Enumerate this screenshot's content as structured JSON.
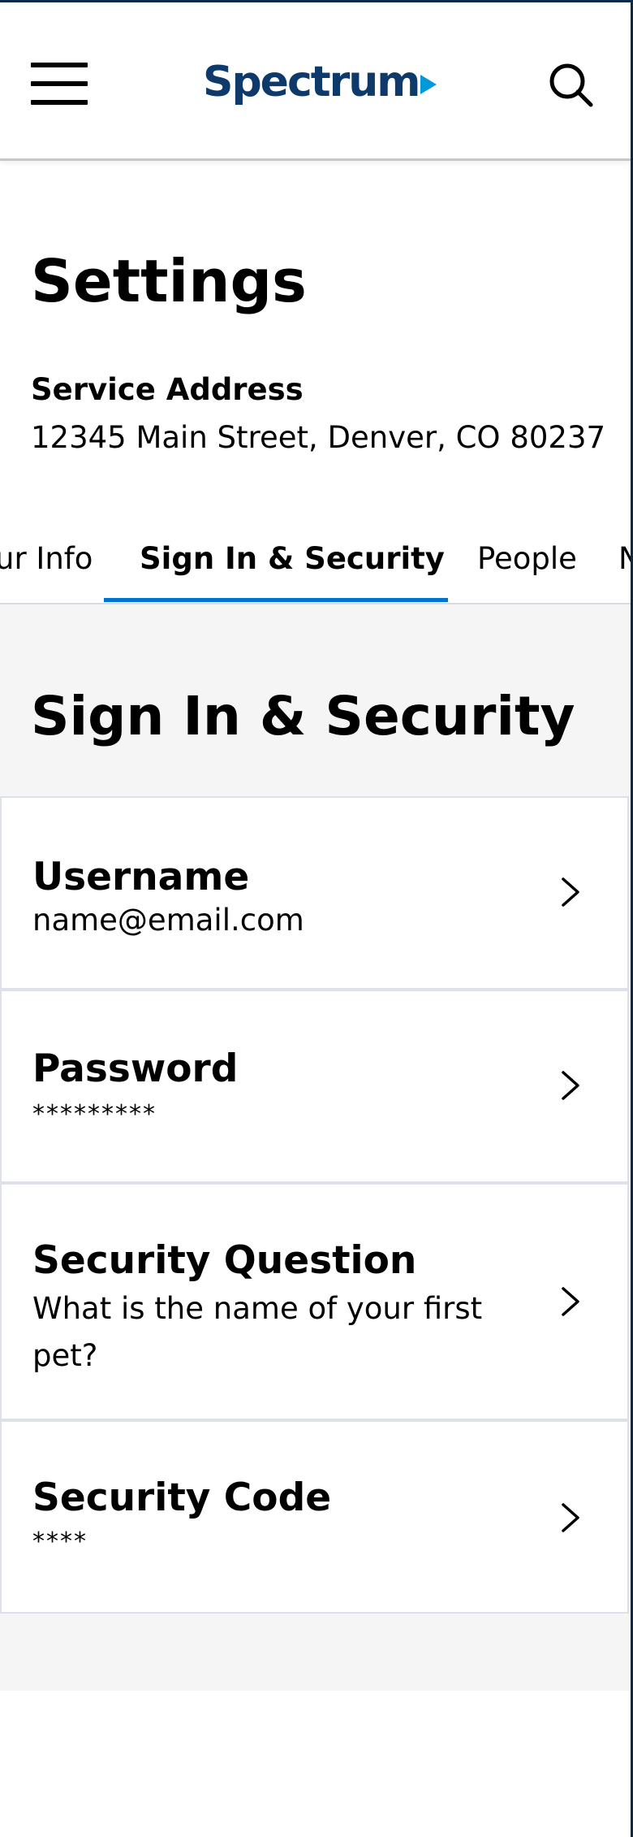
{
  "header": {
    "logo_text": "Spectrum",
    "icons": {
      "menu": "hamburger-menu-icon",
      "search": "search-icon"
    },
    "colors": {
      "logo": "#0e3a6b",
      "logo_accent": "#0099d8"
    }
  },
  "page": {
    "title": "Settings",
    "service_address_label": "Service Address",
    "service_address": "12345 Main Street, Denver, CO 80237"
  },
  "tabs": [
    {
      "label": "ur Info",
      "active": false
    },
    {
      "label": "Sign In & Security",
      "active": true
    },
    {
      "label": "People",
      "active": false
    },
    {
      "label": "N",
      "active": false
    }
  ],
  "tab_indicator_color": "#0073d1",
  "section": {
    "title": "Sign In & Security",
    "items": [
      {
        "title": "Username",
        "value": "name@email.com"
      },
      {
        "title": "Password",
        "value": "*********"
      },
      {
        "title": "Security Question",
        "value": "What is the name of your first pet?"
      },
      {
        "title": "Security Code",
        "value": "****"
      }
    ]
  }
}
